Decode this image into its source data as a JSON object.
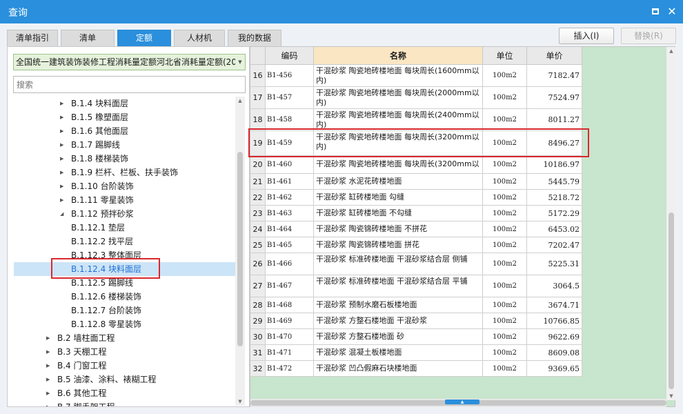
{
  "window": {
    "title": "查询",
    "maximize_icon": "maximize-icon",
    "close_icon": "close-icon",
    "close_glyph": "✕"
  },
  "tabs": [
    "清单指引",
    "清单",
    "定额",
    "人材机",
    "我的数据"
  ],
  "active_tab": "定额",
  "buttons": {
    "insert": "插入(I)",
    "replace": "替换(R)"
  },
  "left": {
    "dropdown_value": "全国统一建筑装饰装修工程消耗量定额河北省消耗量定额(20",
    "search_placeholder": "搜索",
    "tree": [
      {
        "label": "B.1.4 块料面层",
        "level": 1,
        "expander": "▶"
      },
      {
        "label": "B.1.5 橡塑面层",
        "level": 1,
        "expander": "▶"
      },
      {
        "label": "B.1.6 其他面层",
        "level": 1,
        "expander": "▶"
      },
      {
        "label": "B.1.7 踢脚线",
        "level": 1,
        "expander": "▶"
      },
      {
        "label": "B.1.8 楼梯装饰",
        "level": 1,
        "expander": "▶"
      },
      {
        "label": "B.1.9 栏杆、栏板、扶手装饰",
        "level": 1,
        "expander": "▶"
      },
      {
        "label": "B.1.10 台阶装饰",
        "level": 1,
        "expander": "▶"
      },
      {
        "label": "B.1.11 零星装饰",
        "level": 1,
        "expander": "▶"
      },
      {
        "label": "B.1.12 预拌砂浆",
        "level": 1,
        "expander": "◢"
      },
      {
        "label": "B.1.12.1 垫层",
        "level": 2,
        "expander": ""
      },
      {
        "label": "B.1.12.2 找平层",
        "level": 2,
        "expander": ""
      },
      {
        "label": "B.1.12.3 整体面层",
        "level": 2,
        "expander": ""
      },
      {
        "label": "B.1.12.4 块料面层",
        "level": 2,
        "expander": "",
        "selected": true
      },
      {
        "label": "B.1.12.5 踢脚线",
        "level": 2,
        "expander": ""
      },
      {
        "label": "B.1.12.6 楼梯装饰",
        "level": 2,
        "expander": ""
      },
      {
        "label": "B.1.12.7 台阶装饰",
        "level": 2,
        "expander": ""
      },
      {
        "label": "B.1.12.8 零星装饰",
        "level": 2,
        "expander": ""
      },
      {
        "label": "B.2 墙柱面工程",
        "level": 0,
        "expander": "▶"
      },
      {
        "label": "B.3 天棚工程",
        "level": 0,
        "expander": "▶"
      },
      {
        "label": "B.4 门窗工程",
        "level": 0,
        "expander": "▶"
      },
      {
        "label": "B.5 油漆、涂料、裱糊工程",
        "level": 0,
        "expander": "▶"
      },
      {
        "label": "B.6 其他工程",
        "level": 0,
        "expander": "▶"
      },
      {
        "label": "B.7 脚手架工程",
        "level": 0,
        "expander": "▶"
      }
    ]
  },
  "grid": {
    "headers": {
      "code": "编码",
      "name": "名称",
      "unit": "单位",
      "price": "单价"
    },
    "rows": [
      {
        "num": "16",
        "code": "B1-456",
        "name": "干混砂浆 陶瓷地砖楼地面 每块周长(1600mm以内)",
        "unit": "100m2",
        "price": "7182.47"
      },
      {
        "num": "17",
        "code": "B1-457",
        "name": "干混砂浆 陶瓷地砖楼地面 每块周长(2000mm以内)",
        "unit": "100m2",
        "price": "7524.97"
      },
      {
        "num": "18",
        "code": "B1-458",
        "name": "干混砂浆 陶瓷地砖楼地面 每块周长(2400mm以内)",
        "unit": "100m2",
        "price": "8011.27"
      },
      {
        "num": "19",
        "code": "B1-459",
        "name": "干混砂浆 陶瓷地砖楼地面 每块周长(3200mm以内)",
        "unit": "100m2",
        "price": "8496.27",
        "highlighted": true
      },
      {
        "num": "20",
        "code": "B1-460",
        "name": "干混砂浆 陶瓷地砖楼地面 每块周长(3200mm以外)",
        "unit": "100m2",
        "price": "10186.97"
      },
      {
        "num": "21",
        "code": "B1-461",
        "name": "干混砂浆 水泥花砖楼地面",
        "unit": "100m2",
        "price": "5445.79"
      },
      {
        "num": "22",
        "code": "B1-462",
        "name": "干混砂浆 缸砖楼地面 勾缝",
        "unit": "100m2",
        "price": "5218.72"
      },
      {
        "num": "23",
        "code": "B1-463",
        "name": "干混砂浆 缸砖楼地面 不勾缝",
        "unit": "100m2",
        "price": "5172.29"
      },
      {
        "num": "24",
        "code": "B1-464",
        "name": "干混砂浆 陶瓷锦砖楼地面 不拼花",
        "unit": "100m2",
        "price": "6453.02"
      },
      {
        "num": "25",
        "code": "B1-465",
        "name": "干混砂浆 陶瓷锦砖楼地面 拼花",
        "unit": "100m2",
        "price": "7202.47"
      },
      {
        "num": "26",
        "code": "B1-466",
        "name": "干混砂浆 标准砖楼地面 干混砂浆结合层 侧铺",
        "unit": "100m2",
        "price": "5225.31"
      },
      {
        "num": "27",
        "code": "B1-467",
        "name": "干混砂浆 标准砖楼地面 干混砂浆结合层 平铺",
        "unit": "100m2",
        "price": "3064.5"
      },
      {
        "num": "28",
        "code": "B1-468",
        "name": "干混砂浆 预制水磨石板楼地面",
        "unit": "100m2",
        "price": "3674.71"
      },
      {
        "num": "29",
        "code": "B1-469",
        "name": "干混砂浆 方整石楼地面 干混砂浆",
        "unit": "100m2",
        "price": "10766.85"
      },
      {
        "num": "30",
        "code": "B1-470",
        "name": "干混砂浆 方整石楼地面 砂",
        "unit": "100m2",
        "price": "9622.69"
      },
      {
        "num": "31",
        "code": "B1-471",
        "name": "干混砂浆 混凝土板楼地面",
        "unit": "100m2",
        "price": "8609.08"
      },
      {
        "num": "32",
        "code": "B1-472",
        "name": "干混砂浆 凹凸假麻石块楼地面",
        "unit": "100m2",
        "price": "9369.65"
      }
    ]
  },
  "colors": {
    "title_bar": "#2a8fdc",
    "active_tab": "#2a8fdc",
    "grid_bg": "#c8e5cd",
    "header_name": "#fbe6c4",
    "highlight": "#d9272d",
    "selection": "#cce4f7"
  }
}
